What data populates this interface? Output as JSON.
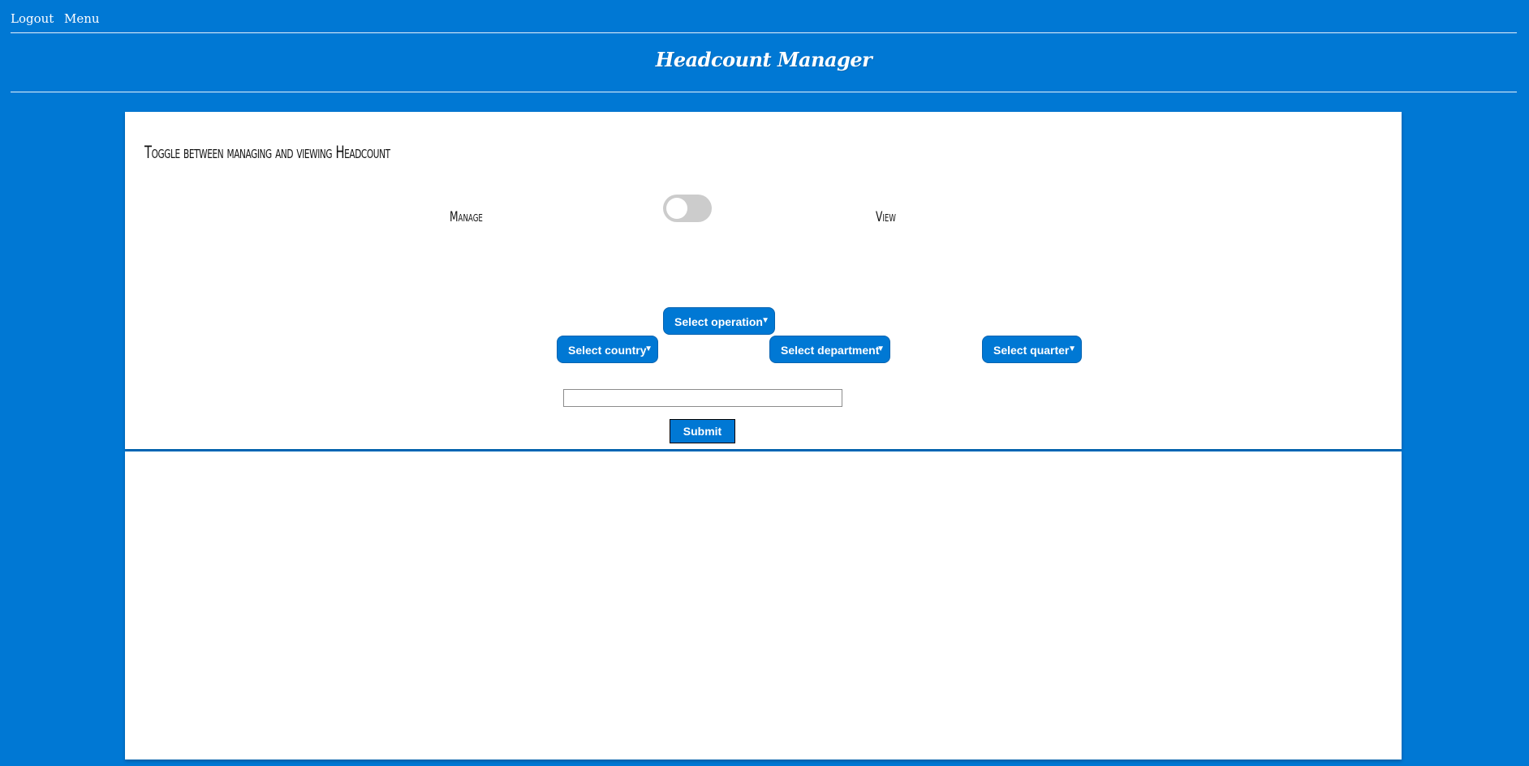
{
  "nav": {
    "logout_label": "Logout",
    "menu_label": "Menu"
  },
  "header": {
    "title": "Headcount Manager"
  },
  "panel": {
    "heading": "Toggle between managing and viewing Headcount",
    "manage_label": "Manage",
    "view_label": "View",
    "toggle_state": "off"
  },
  "filters": {
    "operation": "Select operation",
    "country": "Select country",
    "department": "Select department",
    "quarter": "Select quarter"
  },
  "form": {
    "input_value": "",
    "submit_label": "Submit"
  },
  "colors": {
    "brand": "#0078d4",
    "toggle_track": "#cccccc"
  }
}
